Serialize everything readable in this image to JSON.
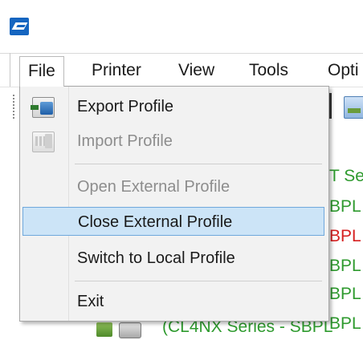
{
  "menubar": {
    "items": [
      {
        "label": "File"
      },
      {
        "label": "Printer"
      },
      {
        "label": "View"
      },
      {
        "label": "Tools"
      },
      {
        "label": "Opti"
      }
    ]
  },
  "file_menu": {
    "items": [
      {
        "label": "Export Profile",
        "enabled": true,
        "icon": "export-profile-icon"
      },
      {
        "label": "Import Profile",
        "enabled": false,
        "icon": "import-profile-icon"
      },
      {
        "label": "Open External Profile",
        "enabled": false
      },
      {
        "label": "Close External Profile",
        "enabled": true,
        "highlighted": true
      },
      {
        "label": "Switch to Local Profile",
        "enabled": true
      },
      {
        "label": "Exit",
        "enabled": true
      }
    ]
  },
  "background_tree": {
    "row_fragments": [
      "T Se",
      "BPL",
      "BPL",
      "BPL",
      "BPL",
      "BPL"
    ],
    "bottom_row_text": "(CL4NX Series - SBPL"
  },
  "colors": {
    "menu_background": "#f2f2f2",
    "highlight_fill": "#cce4f7",
    "highlight_border": "#6fa8dc",
    "disabled_text": "#8d8d8d",
    "tree_green": "#2e9a2e",
    "tree_red": "#d62020",
    "app_logo_blue": "#1565c0"
  }
}
